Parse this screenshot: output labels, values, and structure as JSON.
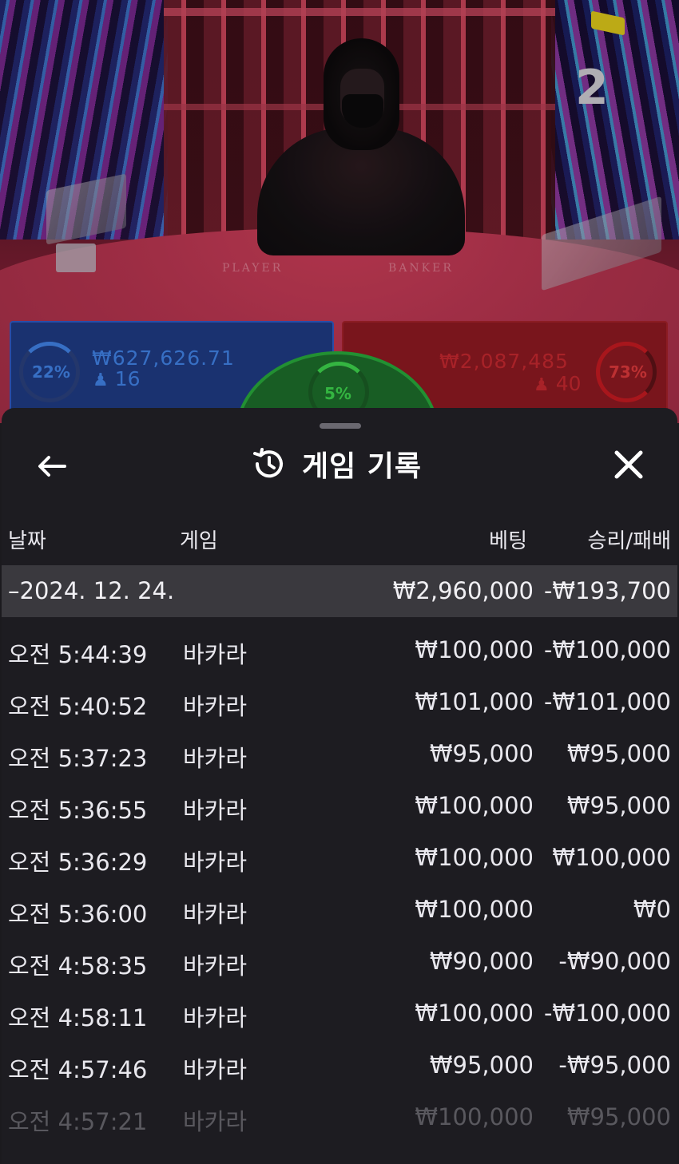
{
  "video": {
    "countdown": "2",
    "felt_player": "PLAYER",
    "felt_banker": "BANKER",
    "player": {
      "percent": "22%",
      "amount": "₩627,626.71",
      "players": "16"
    },
    "banker": {
      "percent": "73%",
      "amount": "₩2,087,485",
      "players": "40"
    },
    "tie": {
      "percent": "5%"
    },
    "colors": {
      "player": "#3f7fe0",
      "banker": "#c0272e",
      "tie": "#3ccf4a"
    }
  },
  "sheet": {
    "title": "게임 기록",
    "icons": {
      "back": "arrow-left-icon",
      "history": "history-icon",
      "close": "close-icon"
    },
    "columns": {
      "date": "날짜",
      "game": "게임",
      "bet": "베팅",
      "result": "승리/패배"
    },
    "date_group": {
      "label": "–2024. 12. 24.",
      "bet_total": "₩2,960,000",
      "result_total": "-₩193,700"
    },
    "rows": [
      {
        "time": "오전 5:44:39",
        "game": "바카라",
        "bet": "₩100,000",
        "result": "-₩100,000"
      },
      {
        "time": "오전 5:40:52",
        "game": "바카라",
        "bet": "₩101,000",
        "result": "-₩101,000"
      },
      {
        "time": "오전 5:37:23",
        "game": "바카라",
        "bet": "₩95,000",
        "result": "₩95,000"
      },
      {
        "time": "오전 5:36:55",
        "game": "바카라",
        "bet": "₩100,000",
        "result": "₩95,000"
      },
      {
        "time": "오전 5:36:29",
        "game": "바카라",
        "bet": "₩100,000",
        "result": "₩100,000"
      },
      {
        "time": "오전 5:36:00",
        "game": "바카라",
        "bet": "₩100,000",
        "result": "₩0"
      },
      {
        "time": "오전 4:58:35",
        "game": "바카라",
        "bet": "₩90,000",
        "result": "-₩90,000"
      },
      {
        "time": "오전 4:58:11",
        "game": "바카라",
        "bet": "₩100,000",
        "result": "-₩100,000"
      },
      {
        "time": "오전 4:57:46",
        "game": "바카라",
        "bet": "₩95,000",
        "result": "-₩95,000"
      },
      {
        "time": "오전 4:57:21",
        "game": "바카라",
        "bet": "₩100,000",
        "result": "₩95,000"
      }
    ]
  }
}
